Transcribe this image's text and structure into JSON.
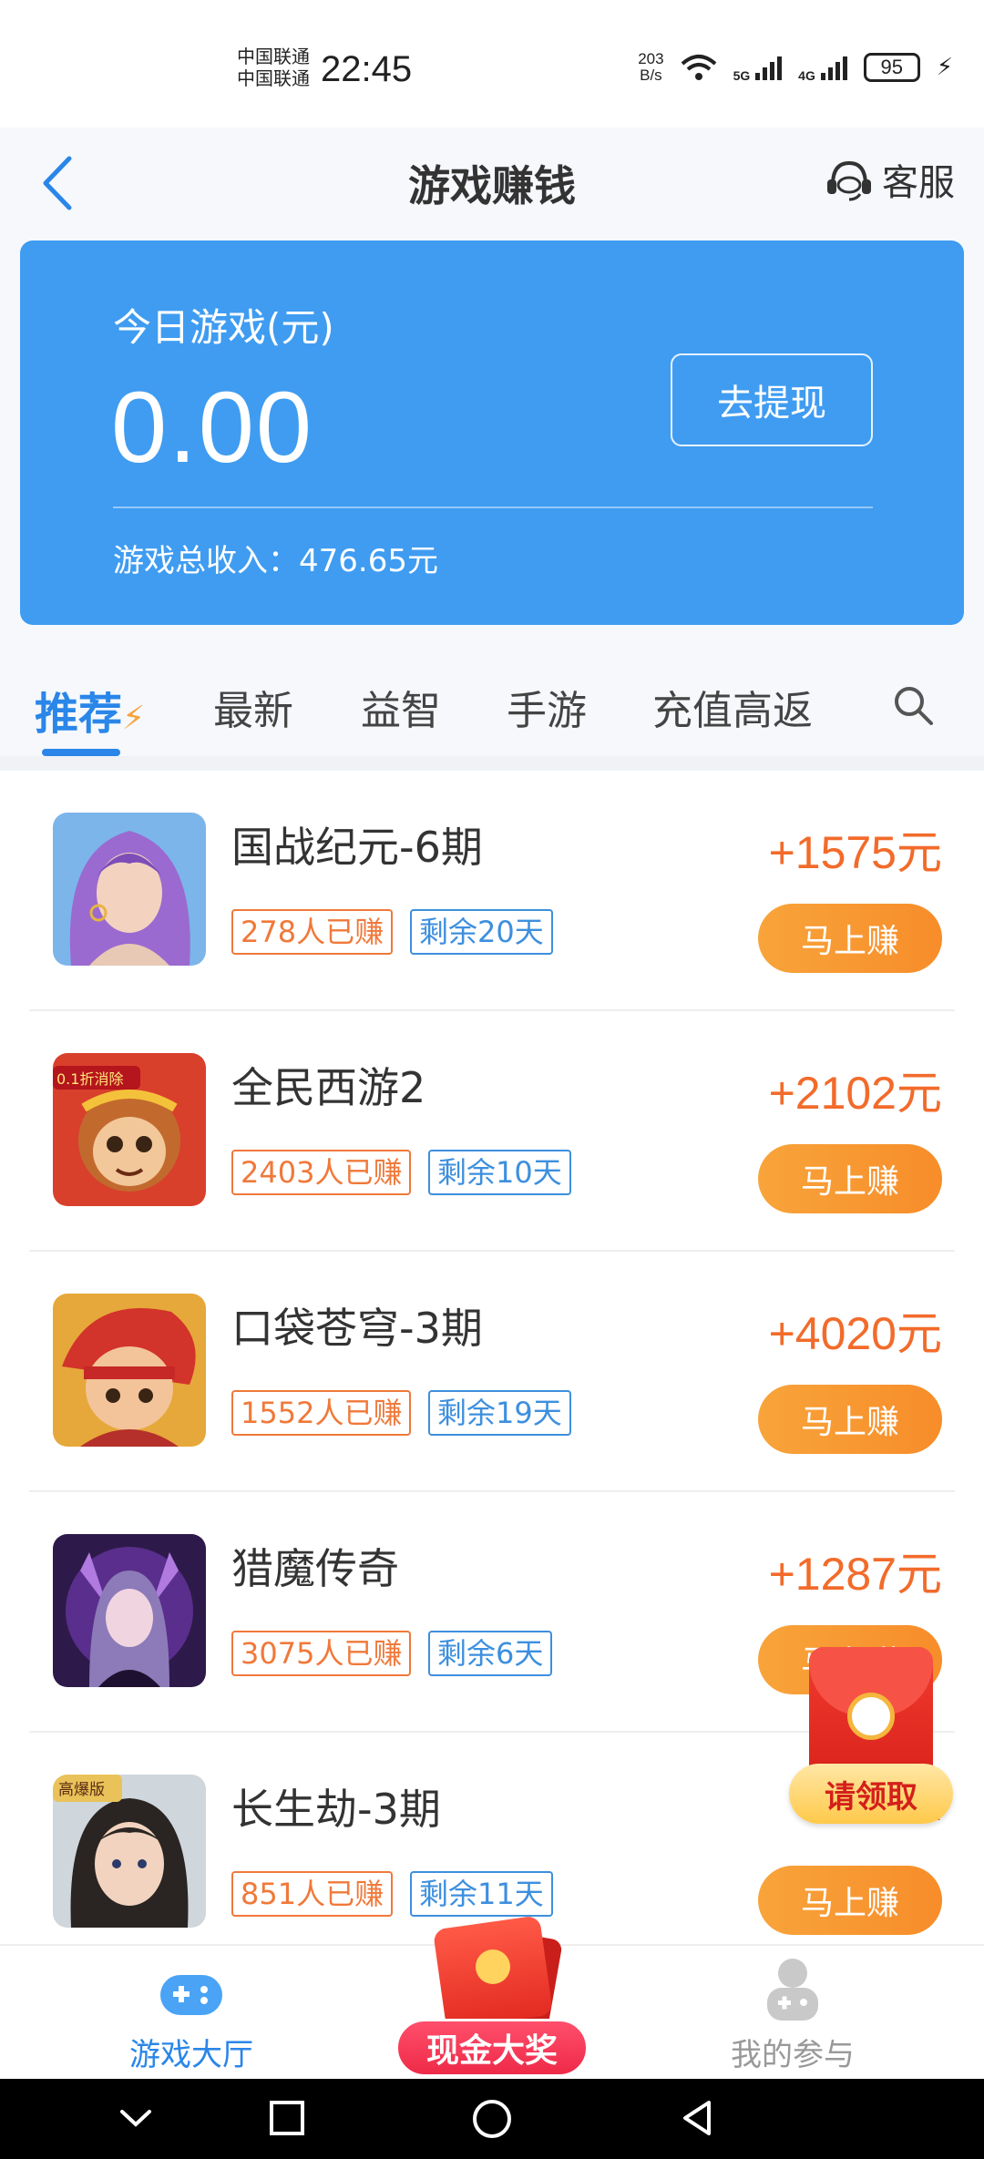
{
  "status_bar": {
    "carrier_1": "中国联通",
    "carrier_2": "中国联通",
    "time": "22:45",
    "net_speed_value": "203",
    "net_speed_unit": "B/s",
    "signal_1": "5G",
    "signal_2": "4G",
    "battery": "95"
  },
  "header": {
    "title": "游戏赚钱",
    "service_label": "客服"
  },
  "earnings_card": {
    "label": "今日游戏(元)",
    "amount": "0.00",
    "withdraw_label": "去提现",
    "total_income": "游戏总收入：476.65元"
  },
  "tabs": [
    {
      "label": "推荐",
      "active": true
    },
    {
      "label": "最新",
      "active": false
    },
    {
      "label": "益智",
      "active": false
    },
    {
      "label": "手游",
      "active": false
    },
    {
      "label": "充值高返",
      "active": false
    }
  ],
  "games": [
    {
      "name": "国战纪元-6期",
      "reward": "+1575",
      "earned": "278人已赚",
      "remaining": "剩余20天",
      "button": "马上赚"
    },
    {
      "name": "全民西游2",
      "reward": "+2102",
      "earned": "2403人已赚",
      "remaining": "剩余10天",
      "button": "马上赚",
      "thumb_badge": "0.1折消除"
    },
    {
      "name": "口袋苍穹-3期",
      "reward": "+4020",
      "earned": "1552人已赚",
      "remaining": "剩余19天",
      "button": "马上赚"
    },
    {
      "name": "猎魔传奇",
      "reward": "+1287",
      "earned": "3075人已赚",
      "remaining": "剩余6天",
      "button": "马上赚"
    },
    {
      "name": "长生劫-3期",
      "reward": "+2",
      "earned": "851人已赚",
      "remaining": "剩余11天",
      "button": "马上赚",
      "thumb_badge": "高爆版"
    }
  ],
  "reward_unit": "元",
  "floating_redpacket": {
    "label": "请领取"
  },
  "bottom_nav": {
    "hall": "游戏大厅",
    "prize": "现金大奖",
    "mine": "我的参与"
  },
  "colors": {
    "primary_blue": "#3f9cf1",
    "accent_orange": "#f26b2b",
    "button_orange": "#f8a43a",
    "tag_blue": "#3d8fde"
  }
}
